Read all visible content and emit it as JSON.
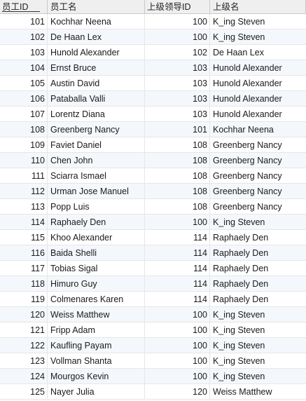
{
  "table": {
    "columns": [
      "员工ID",
      "员工名",
      "上级领导ID",
      "上级名"
    ],
    "rows": [
      [
        "101",
        "Kochhar Neena",
        "100",
        "K_ing Steven"
      ],
      [
        "102",
        "De Haan Lex",
        "100",
        "K_ing Steven"
      ],
      [
        "103",
        "Hunold Alexander",
        "102",
        "De Haan Lex"
      ],
      [
        "104",
        "Ernst Bruce",
        "103",
        "Hunold Alexander"
      ],
      [
        "105",
        "Austin David",
        "103",
        "Hunold Alexander"
      ],
      [
        "106",
        "Pataballa Valli",
        "103",
        "Hunold Alexander"
      ],
      [
        "107",
        "Lorentz Diana",
        "103",
        "Hunold Alexander"
      ],
      [
        "108",
        "Greenberg Nancy",
        "101",
        "Kochhar Neena"
      ],
      [
        "109",
        "Faviet Daniel",
        "108",
        "Greenberg Nancy"
      ],
      [
        "110",
        "Chen John",
        "108",
        "Greenberg Nancy"
      ],
      [
        "111",
        "Sciarra Ismael",
        "108",
        "Greenberg Nancy"
      ],
      [
        "112",
        "Urman Jose Manuel",
        "108",
        "Greenberg Nancy"
      ],
      [
        "113",
        "Popp Luis",
        "108",
        "Greenberg Nancy"
      ],
      [
        "114",
        "Raphaely Den",
        "100",
        "K_ing Steven"
      ],
      [
        "115",
        "Khoo Alexander",
        "114",
        "Raphaely Den"
      ],
      [
        "116",
        "Baida Shelli",
        "114",
        "Raphaely Den"
      ],
      [
        "117",
        "Tobias Sigal",
        "114",
        "Raphaely Den"
      ],
      [
        "118",
        "Himuro Guy",
        "114",
        "Raphaely Den"
      ],
      [
        "119",
        "Colmenares Karen",
        "114",
        "Raphaely Den"
      ],
      [
        "120",
        "Weiss Matthew",
        "100",
        "K_ing Steven"
      ],
      [
        "121",
        "Fripp Adam",
        "100",
        "K_ing Steven"
      ],
      [
        "122",
        "Kaufling Payam",
        "100",
        "K_ing Steven"
      ],
      [
        "123",
        "Vollman Shanta",
        "100",
        "K_ing Steven"
      ],
      [
        "124",
        "Mourgos Kevin",
        "100",
        "K_ing Steven"
      ],
      [
        "125",
        "Nayer Julia",
        "120",
        "Weiss Matthew"
      ]
    ]
  }
}
